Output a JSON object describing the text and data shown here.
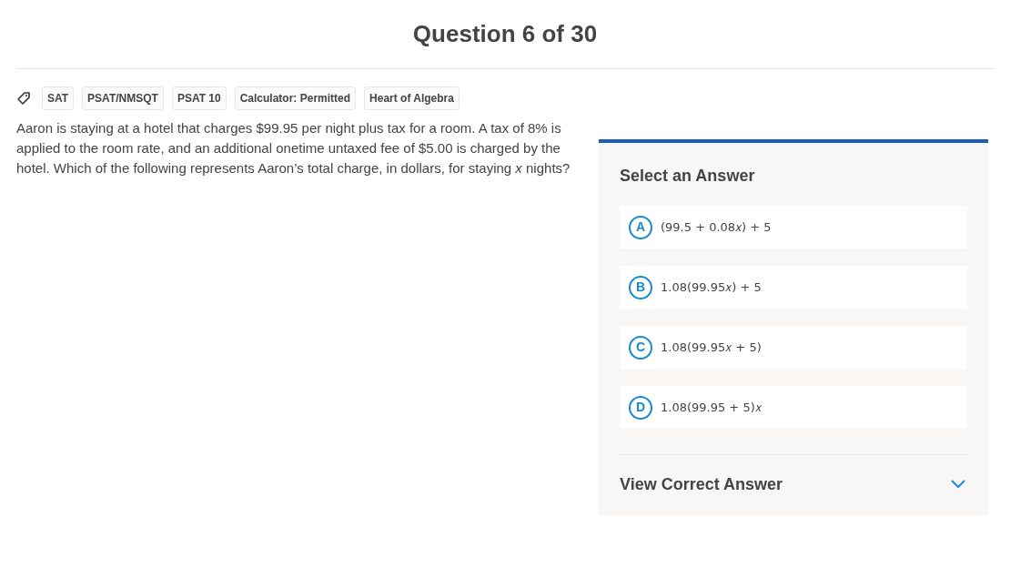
{
  "title": "Question 6 of 30",
  "tags": [
    "SAT",
    "PSAT/NMSQT",
    "PSAT 10",
    "Calculator: Permitted",
    "Heart of Algebra"
  ],
  "question": "Aaron is staying at a hotel that charges $99.95 per night plus tax for a room. A tax of 8% is applied to the room rate, and an additional onetime untaxed fee of $5.00 is charged by the hotel. Which of the following represents Aaron’s total charge, in dollars, for staying *x* nights?",
  "answer_panel": {
    "heading": "Select an Answer",
    "choices": [
      {
        "letter": "A",
        "text": "(99.5 + 0.08𝑥) + 5",
        "selected": false
      },
      {
        "letter": "B",
        "text": "1.08(99.95𝑥) + 5",
        "selected": false
      },
      {
        "letter": "C",
        "text": "1.08(99.95𝑥 + 5)",
        "selected": false
      },
      {
        "letter": "D",
        "text": "1.08(99.95 + 5)𝑥",
        "selected": false
      }
    ],
    "reveal": {
      "label": "View Correct Answer",
      "expanded": false
    }
  }
}
